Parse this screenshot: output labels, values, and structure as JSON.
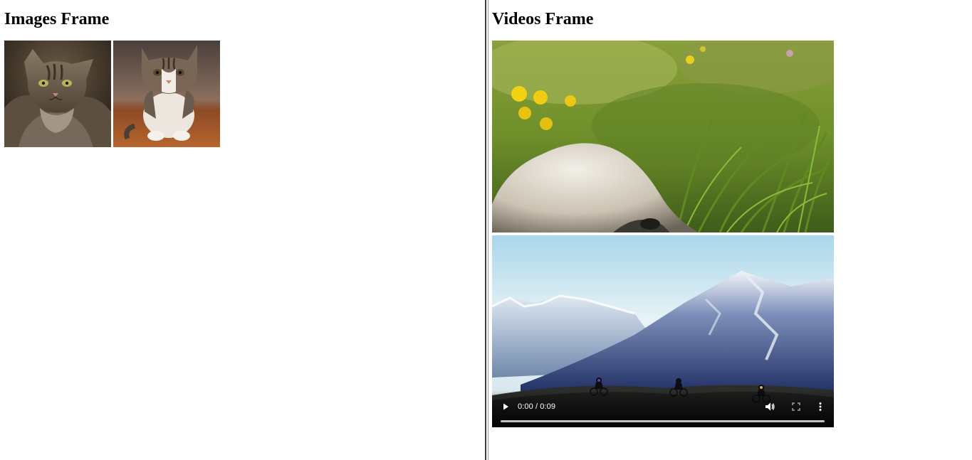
{
  "images_frame": {
    "title": "Images Frame",
    "images": [
      {
        "name": "cat-looking-up",
        "alt": ""
      },
      {
        "name": "kitten-sitting",
        "alt": ""
      }
    ]
  },
  "videos_frame": {
    "title": "Videos Frame",
    "videos": [
      {
        "name": "meadow-animal-video",
        "show_controls": false
      },
      {
        "name": "mountain-cyclists-video",
        "show_controls": true,
        "time": "0:00 / 0:09",
        "icons": {
          "play": "play-icon",
          "volume": "volume-icon",
          "fullscreen": "fullscreen-icon",
          "menu": "more-options-icon"
        }
      }
    ]
  },
  "colors": {
    "divider": "#3c3c3c",
    "background": "#ffffff"
  }
}
